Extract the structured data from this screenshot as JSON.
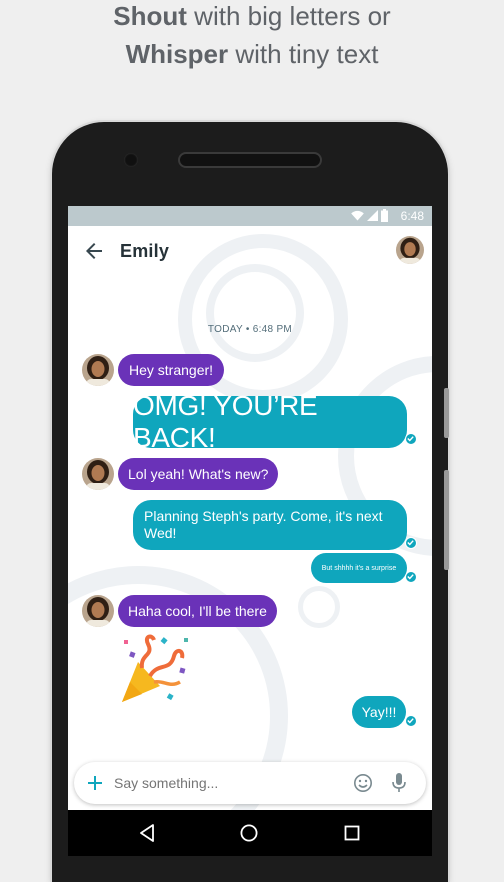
{
  "promo": {
    "shout": "Shout",
    "line1_rest": " with big letters or",
    "whisper": "Whisper",
    "line2_rest": " with tiny text"
  },
  "status": {
    "time": "6:48"
  },
  "header": {
    "contact_name": "Emily"
  },
  "chat": {
    "date_label": "TODAY • 6:48 PM",
    "messages": [
      {
        "from": "them",
        "text": "Hey stranger!"
      },
      {
        "from": "me",
        "text": "OMG! YOU’RE BACK!"
      },
      {
        "from": "them",
        "text": "Lol yeah! What's new?"
      },
      {
        "from": "me",
        "text": "Planning Steph's party. Come, it's next Wed!"
      },
      {
        "from": "me",
        "text": "But shhhh it's a surprise"
      },
      {
        "from": "them",
        "text": "Haha cool, I'll be there"
      },
      {
        "from": "them",
        "sticker": "party-popper"
      },
      {
        "from": "me",
        "text": "Yay!!!"
      }
    ]
  },
  "composer": {
    "placeholder": "Say something..."
  },
  "icons": [
    "back-arrow-icon",
    "wifi-icon",
    "signal-icon",
    "battery-icon",
    "plus-icon",
    "emoji-icon",
    "microphone-icon",
    "nav-back-icon",
    "nav-home-icon",
    "nav-recents-icon",
    "check-icon"
  ],
  "colors": {
    "incoming": "#6a32b8",
    "outgoing": "#0fa6bd",
    "statusbar": "#bcc9cd"
  }
}
